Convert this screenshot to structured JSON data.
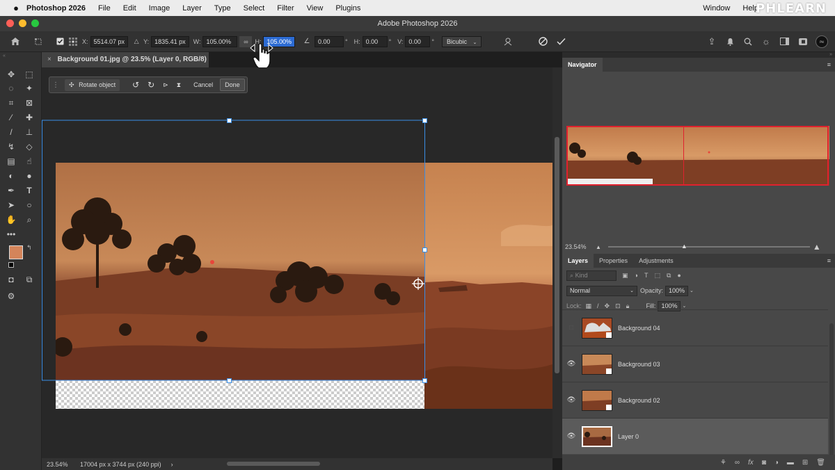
{
  "menubar": {
    "app": "Photoshop 2026",
    "items": [
      "File",
      "Edit",
      "Image",
      "Layer",
      "Type",
      "Select",
      "Filter",
      "View",
      "Plugins"
    ],
    "right_items": [
      "Window",
      "Help"
    ],
    "watermark": "PHLEARN"
  },
  "window": {
    "title": "Adobe Photoshop 2026"
  },
  "options": {
    "x_label": "X:",
    "x_value": "5514.07 px",
    "y_label": "Y:",
    "y_value": "1835.41 px",
    "w_label": "W:",
    "w_value": "105.00%",
    "h_label": "H:",
    "h_value": "105.00%",
    "angle_value": "0.00",
    "angle_unit": "°",
    "hskew_label": "H:",
    "hskew_value": "0.00",
    "hskew_unit": "°",
    "vskew_label": "V:",
    "vskew_value": "0.00",
    "vskew_unit": "°",
    "interpolation": "Bicubic"
  },
  "document": {
    "tab_title": "Background 01.jpg @ 23.5% (Layer 0, RGB/8) *",
    "zoom": "23.54%",
    "info": "17004 px x 3744 px (240 ppi)",
    "info_arrow": "›"
  },
  "contextbar": {
    "rotate_label": "Rotate object",
    "cancel_label": "Cancel",
    "done_label": "Done"
  },
  "navigator": {
    "tab": "Navigator",
    "zoom": "23.54%"
  },
  "layers_panel": {
    "tabs": [
      "Layers",
      "Properties",
      "Adjustments"
    ],
    "search_placeholder": "Kind",
    "blend_mode": "Normal",
    "opacity_label": "Opacity:",
    "opacity_value": "100%",
    "lock_label": "Lock:",
    "fill_label": "Fill:",
    "fill_value": "100%",
    "layers": [
      {
        "name": "Background 04",
        "visible": false
      },
      {
        "name": "Background 03",
        "visible": true
      },
      {
        "name": "Background 02",
        "visible": true
      },
      {
        "name": "Layer 0",
        "visible": true,
        "selected": true
      }
    ]
  },
  "colors": {
    "foreground": "#d4845a",
    "background": "#000000",
    "accent": "#2c6bd3",
    "selection_handle": "#3a8ee6"
  },
  "icons": {
    "home": "home-icon",
    "eye": "eye-icon",
    "link": "link-icon"
  }
}
